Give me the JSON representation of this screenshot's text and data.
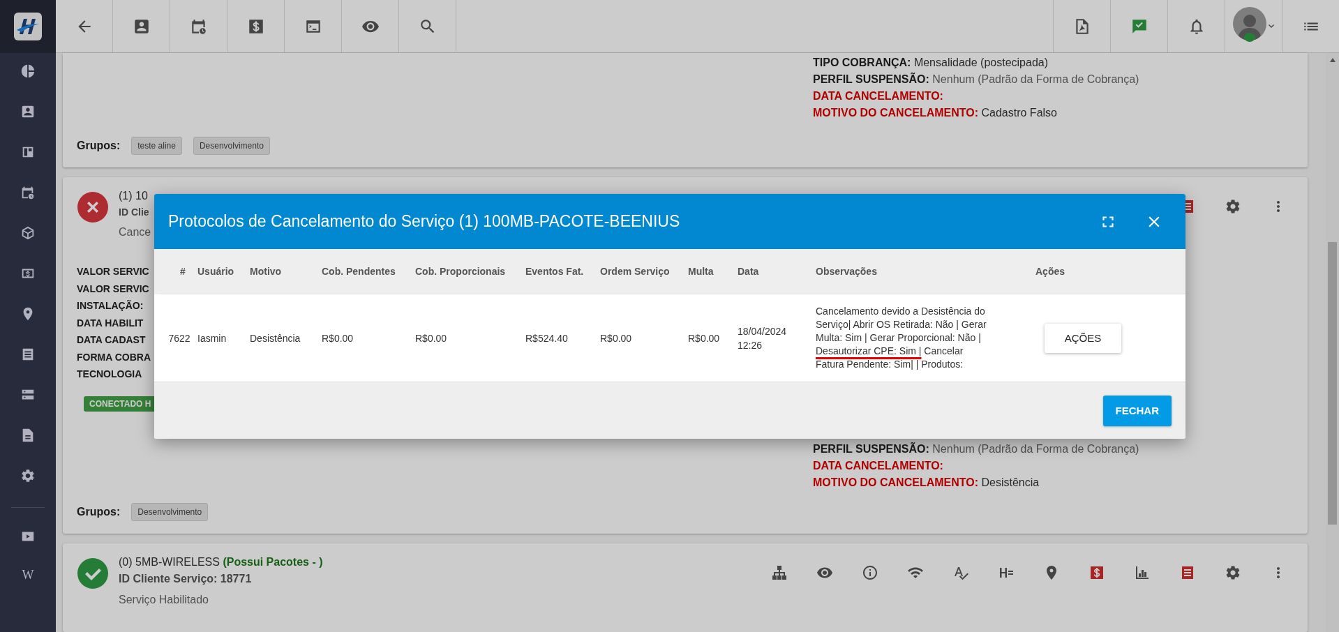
{
  "sidebar": {
    "bottom_label": "W"
  },
  "cards": [
    {
      "kind": "plain",
      "details": [
        {
          "label": "TIPO COBRANÇA:",
          "value": "Mensalidade (postecipada)",
          "kind": "normal"
        },
        {
          "label": "PERFIL SUSPENSÃO:",
          "value": "Nenhum (Padrão da Forma de Cobrança)",
          "kind": "muted"
        },
        {
          "label": "DATA CANCELAMENTO:",
          "kind": "alert"
        },
        {
          "label": "MOTIVO DO CANCELAMENTO:",
          "value": "Cadastro Falso",
          "kind": "alert"
        }
      ],
      "groups_label": "Grupos:",
      "groups": [
        "teste aline",
        "Desenvolvimento"
      ]
    },
    {
      "kind": "cancelled",
      "title": "(1) 10",
      "id_line": "ID Clie",
      "status_text": "Cance",
      "fields": [
        "VALOR SERVIC",
        "VALOR SERVIC",
        "INSTALAÇÃO:",
        "DATA HABILIT",
        "DATA CADAST",
        "FORMA COBRA",
        "TECNOLOGIA"
      ],
      "badge": "CONECTADO H",
      "details": [
        {
          "label": "PERFIL SUSPENSÃO:",
          "value": "Nenhum (Padrão da Forma de Cobrança)",
          "kind": "muted"
        },
        {
          "label": "DATA CANCELAMENTO:",
          "kind": "alert"
        },
        {
          "label": "MOTIVO DO CANCELAMENTO:",
          "value": "Desistência",
          "kind": "alert"
        }
      ],
      "groups_label": "Grupos:",
      "groups": [
        "Desenvolvimento"
      ]
    },
    {
      "kind": "active",
      "title": "(0) 5MB-WIRELESS",
      "title_note": "(Possui Pacotes - )",
      "id_line": "ID Cliente Serviço: 18771",
      "status_text": "Serviço Habilitado"
    }
  ],
  "modal": {
    "title": "Protocolos de Cancelamento do Serviço (1) 100MB-PACOTE-BEENIUS",
    "columns": [
      "#",
      "Usuário",
      "Motivo",
      "Cob. Pendentes",
      "Cob. Proporcionais",
      "Eventos Fat.",
      "Ordem Serviço",
      "Multa",
      "Data",
      "Observações",
      "Ações"
    ],
    "rows": [
      {
        "cells": [
          "7622",
          "Iasmin",
          "Desistência",
          "R$0.00",
          "R$0.00",
          "R$524.40",
          "R$0.00",
          "R$0.00",
          "18/04/2024 12:26"
        ],
        "observations": {
          "before": "Cancelamento devido a Desistência do Serviço| Abrir OS Retirada: Não | Gerar Multa: Sim | Gerar Proporcional: Não | ",
          "highlight": "Desautorizar CPE: Sim |",
          "after": " Cancelar Fatura Pendente: Sim| | Produtos:"
        },
        "action_label": "AÇÕES"
      }
    ],
    "close_label": "FECHAR"
  }
}
